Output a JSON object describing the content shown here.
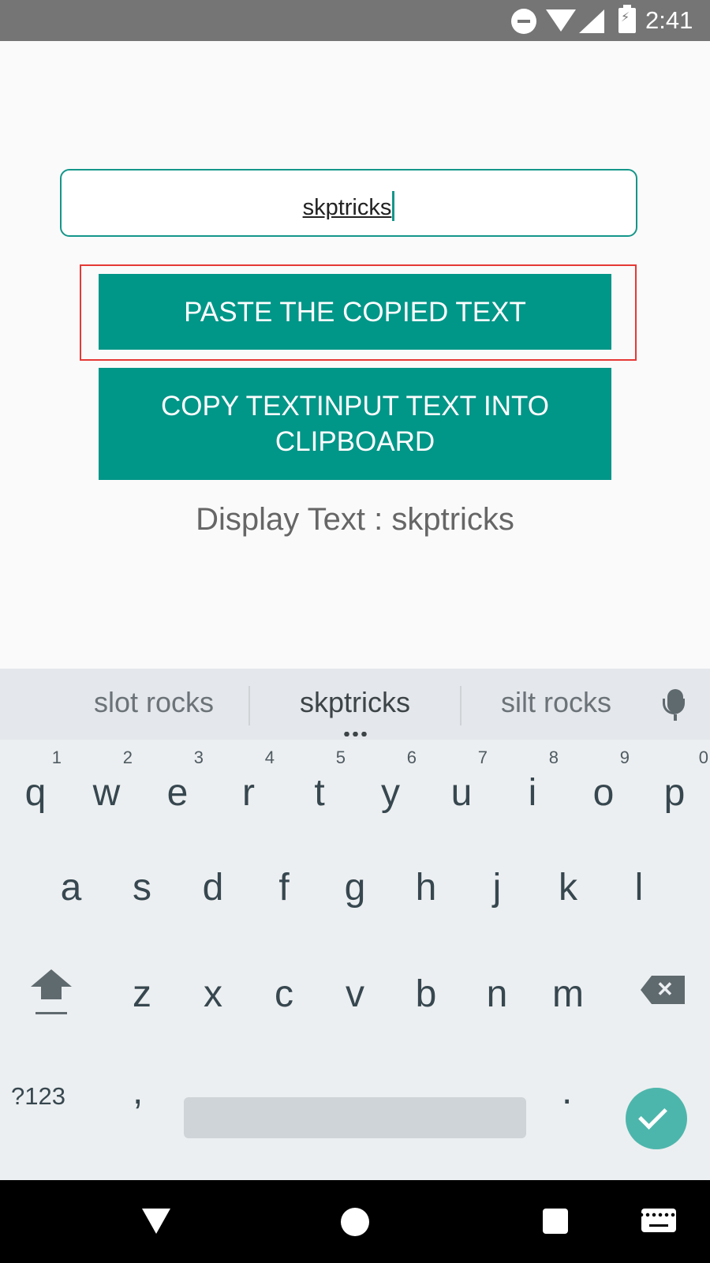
{
  "status_bar": {
    "time": "2:41",
    "icons": [
      "do-not-disturb-icon",
      "wifi-icon",
      "cell-signal-icon",
      "battery-charging-icon"
    ]
  },
  "text_input": {
    "value": "skptricks"
  },
  "buttons": {
    "paste_label": "PASTE THE COPIED TEXT",
    "copy_label": "COPY TEXTINPUT TEXT INTO CLIPBOARD"
  },
  "display_text": "Display Text : skptricks",
  "highlight_color": "#e53935",
  "accent_color": "#009688",
  "keyboard": {
    "suggestions": [
      "slot rocks",
      "skptricks",
      "silt rocks"
    ],
    "row1": [
      {
        "letter": "q",
        "hint": "1"
      },
      {
        "letter": "w",
        "hint": "2"
      },
      {
        "letter": "e",
        "hint": "3"
      },
      {
        "letter": "r",
        "hint": "4"
      },
      {
        "letter": "t",
        "hint": "5"
      },
      {
        "letter": "y",
        "hint": "6"
      },
      {
        "letter": "u",
        "hint": "7"
      },
      {
        "letter": "i",
        "hint": "8"
      },
      {
        "letter": "o",
        "hint": "9"
      },
      {
        "letter": "p",
        "hint": "0"
      }
    ],
    "row2": [
      "a",
      "s",
      "d",
      "f",
      "g",
      "h",
      "j",
      "k",
      "l"
    ],
    "row3": [
      "z",
      "x",
      "c",
      "v",
      "b",
      "n",
      "m"
    ],
    "symbols_label": "?123",
    "comma": ",",
    "period": "."
  }
}
